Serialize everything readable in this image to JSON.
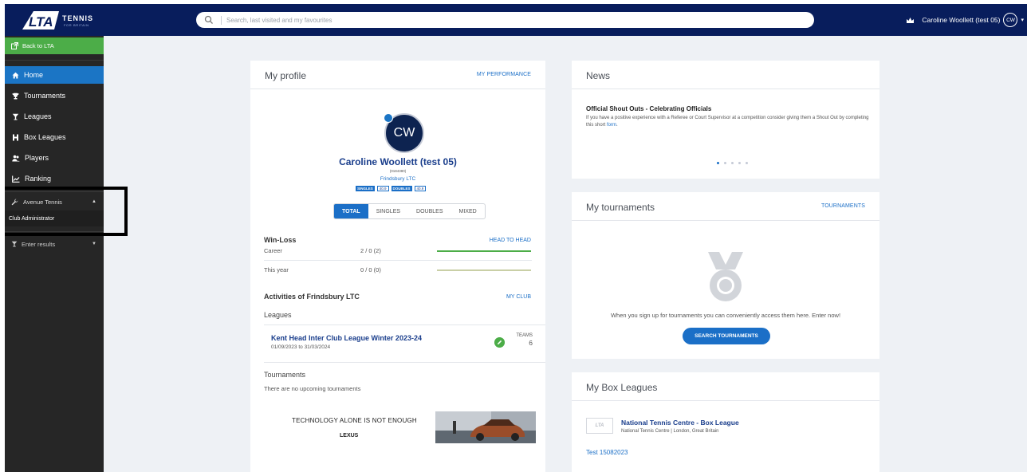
{
  "header": {
    "logo_text": "LTA",
    "logo_sub": "TENNIS",
    "logo_sub2": "FOR BRITAIN",
    "search_placeholder": "Search, last visited and my favourites",
    "user_name": "Caroline Woollett (test 05)",
    "user_initials": "CW",
    "caret": "▾"
  },
  "sidebar": {
    "back": "Back to LTA",
    "items": [
      {
        "label": "Home",
        "icon": "home-icon"
      },
      {
        "label": "Tournaments",
        "icon": "trophy-icon"
      },
      {
        "label": "Leagues",
        "icon": "cup-icon"
      },
      {
        "label": "Box Leagues",
        "icon": "h-icon"
      },
      {
        "label": "Players",
        "icon": "players-icon"
      },
      {
        "label": "Ranking",
        "icon": "ranking-icon"
      }
    ],
    "org_name": "Avenue Tennis",
    "org_caret": "▲",
    "role": "Club Administrator",
    "enter_results": "Enter results",
    "enter_caret": "▼"
  },
  "profile": {
    "title": "My profile",
    "link": "MY PERFORMANCE",
    "initials": "CW",
    "name": "Caroline Woollett (test 05)",
    "id": "(0184380)",
    "club": "Frindsbury LTC",
    "singles_label": "SINGLES",
    "singles_value": "40.9",
    "doubles_label": "DOUBLES",
    "doubles_value": "40.9",
    "tabs": [
      "TOTAL",
      "SINGLES",
      "DOUBLES",
      "MIXED"
    ],
    "winloss_title": "Win-Loss",
    "winloss_link": "HEAD TO HEAD",
    "winloss_rows": [
      {
        "label": "Career",
        "value": "2 / 0 (2)",
        "fraction": 1,
        "color": "#4cad48"
      },
      {
        "label": "This year",
        "value": "0 / 0 (0)",
        "fraction": 1,
        "color": "#c9cfa6"
      }
    ],
    "activities_title": "Activities of Frindsbury LTC",
    "activities_link": "MY CLUB",
    "leagues_label": "Leagues",
    "league_name": "Kent Head Inter Club League Winter 2023-24",
    "league_dates": "01/09/2023 to 31/03/2024",
    "teams_label": "TEAMS",
    "teams_count": "6",
    "tournaments_label": "Tournaments",
    "tournaments_empty": "There are no upcoming tournaments",
    "ad_text": "TECHNOLOGY ALONE IS NOT ENOUGH",
    "ad_brand": "LEXUS"
  },
  "news": {
    "title": "News",
    "headline": "Official Shout Outs - Celebrating Officials",
    "body": "If you have a positive experience with a Referee or Court Supervisor at a competition consider giving them a Shout Out by completing this short ",
    "body_link": "form",
    "body_end": ".",
    "slides": 5,
    "active_slide": 1
  },
  "tournaments": {
    "title": "My tournaments",
    "link": "TOURNAMENTS",
    "empty_text": "When you sign up for tournaments you can conveniently access them here. Enter now!",
    "button": "SEARCH TOURNAMENTS"
  },
  "boxleagues": {
    "title": "My Box Leagues",
    "logo": "LTA",
    "league_name": "National Tennis Centre - Box League",
    "league_sub": "National Tennis Centre | London, Great Britain",
    "test_link": "Test 15082023"
  },
  "colors": {
    "navy": "#081d5c",
    "accent": "#1b6fc7",
    "green": "#4cad48",
    "sidebar": "#262626"
  }
}
